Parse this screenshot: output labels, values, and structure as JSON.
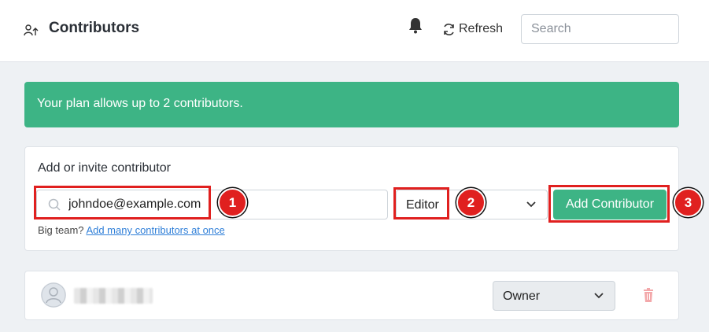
{
  "header": {
    "title": "Contributors",
    "refresh_label": "Refresh",
    "search_placeholder": "Search"
  },
  "alert": {
    "text": "Your plan allows up to 2 contributors."
  },
  "invite": {
    "heading": "Add or invite contributor",
    "email_value": "johndoe@example.com",
    "role_value": "Editor",
    "add_button": "Add Contributor",
    "hint_text": "Big team? ",
    "hint_link": "Add many contributors at once"
  },
  "members": [
    {
      "role": "Owner"
    }
  ],
  "annotations": [
    "1",
    "2",
    "3"
  ],
  "colors": {
    "accent": "#3db485",
    "annotation": "#e0201f",
    "link": "#2f7fd8"
  }
}
